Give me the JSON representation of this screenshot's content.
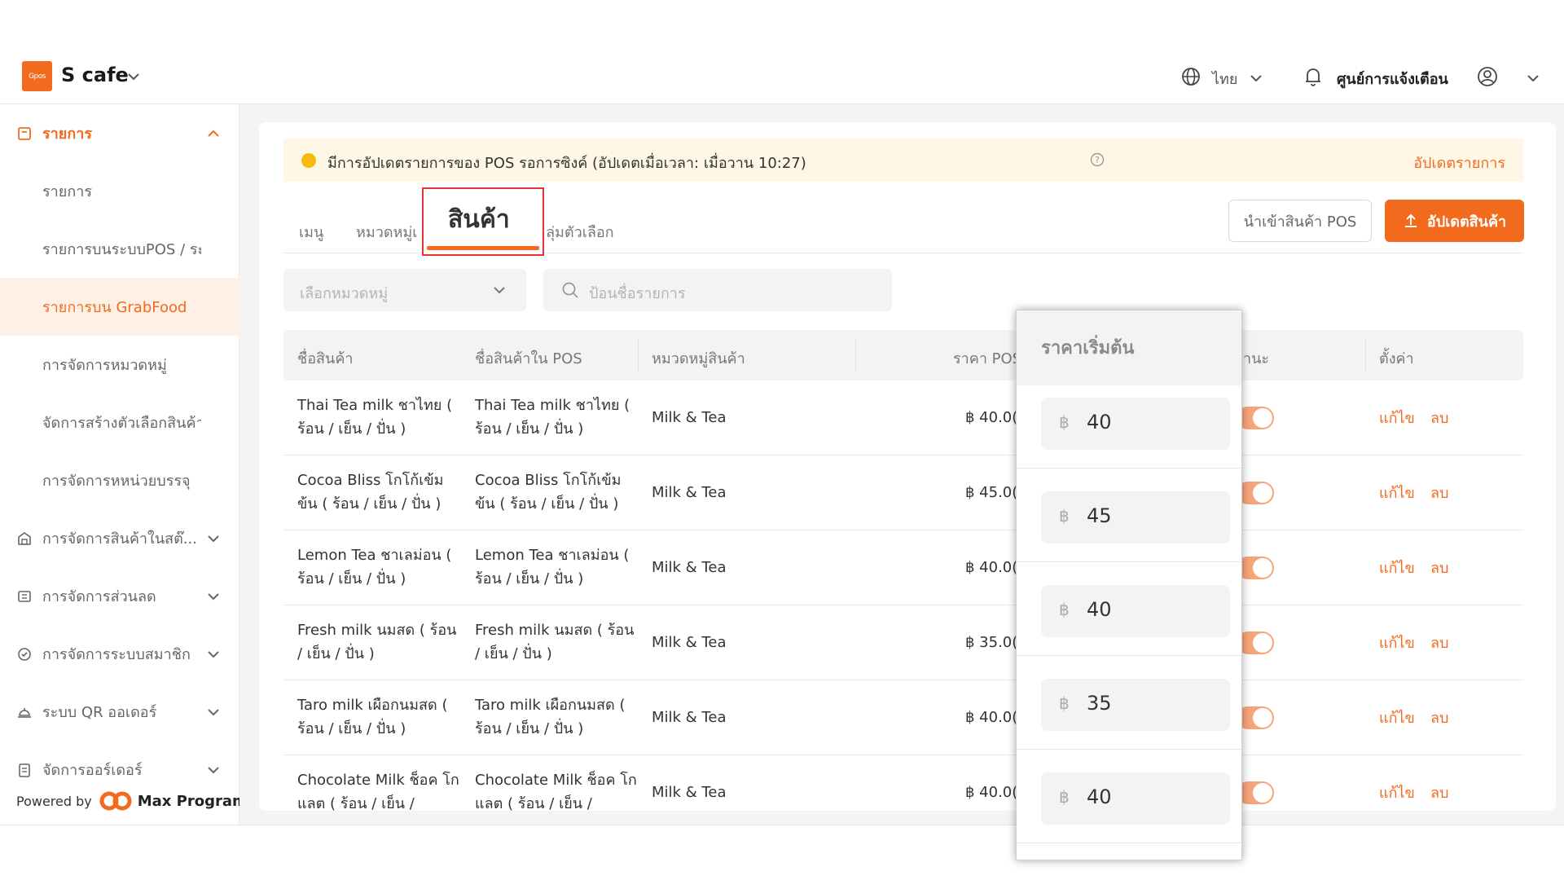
{
  "header": {
    "logo_text": "Gpos",
    "shop_name": "S cafe",
    "language": "ไทย",
    "notifications": "ศูนย์การแจ้งเตือน"
  },
  "sidebar": {
    "items": [
      {
        "label": "รายการ",
        "icon": "list-icon"
      },
      {
        "label": "รายการ"
      },
      {
        "label": "รายการบนระบบPOS / ระ..."
      },
      {
        "label": "รายการบน GrabFood"
      },
      {
        "label": "การจัดการหมวดหมู่"
      },
      {
        "label": "จัดการสร้างตัวเลือกสินค้า"
      },
      {
        "label": "การจัดการหหน่วยบรรจุ"
      },
      {
        "label": "การจัดการสินค้าในสต๊...",
        "icon": "warehouse-icon"
      },
      {
        "label": "การจัดการส่วนลด",
        "icon": "coupon-icon"
      },
      {
        "label": "การจัดการระบบสมาชิก",
        "icon": "member-icon"
      },
      {
        "label": "ระบบ QR ออเดอร์",
        "icon": "qr-order-icon"
      },
      {
        "label": "จัดการออร์เดอร์",
        "icon": "order-icon"
      }
    ],
    "powered_by": "Powered by",
    "brand": "Max Program"
  },
  "notice": {
    "text": "มีการอัปเดตรายการของ POS รอการซิงค์ (อัปเดตเมื่อเวลา: เมื่อวาน 10:27)",
    "link": "อัปเดตรายการ"
  },
  "tabs": {
    "menu": "เมนู",
    "category": "หมวดหมู่เ",
    "product": "สินค้า",
    "options": "ลุ่มตัวเลือก"
  },
  "buttons": {
    "import": "นำเข้าสินค้า POS",
    "update": "อัปเดตสินค้า"
  },
  "filters": {
    "category_placeholder": "เลือกหมวดหมู่",
    "search_placeholder": "ป้อนชื่อรายการ"
  },
  "table": {
    "headers": {
      "name": "ชื่อสินค้า",
      "pos_name": "ชื่อสินค้าใน POS",
      "category": "หมวดหมู่สินค้า",
      "price": "ราคา POS",
      "status": "านะ",
      "settings": "ตั้งค่า"
    },
    "rows": [
      {
        "name": "Thai Tea milk ชาไทย ( ร้อน / เย็น / ปั่น )",
        "pos_name": "Thai Tea milk ชาไทย ( ร้อน / เย็น / ปั่น )",
        "category": "Milk & Tea",
        "price": "฿ 40.0("
      },
      {
        "name": "Cocoa Bliss โกโก้เข้ม ข้น ( ร้อน / เย็น / ปั่น )",
        "pos_name": "Cocoa Bliss โกโก้เข้ม ข้น ( ร้อน / เย็น / ปั่น )",
        "category": "Milk & Tea",
        "price": "฿ 45.0("
      },
      {
        "name": "Lemon Tea ชาเลม่อน ( ร้อน / เย็น / ปั่น )",
        "pos_name": "Lemon Tea ชาเลม่อน ( ร้อน / เย็น / ปั่น )",
        "category": "Milk & Tea",
        "price": "฿ 40.0("
      },
      {
        "name": "Fresh milk นมสด ( ร้อน / เย็น / ปั่น )",
        "pos_name": "Fresh milk นมสด ( ร้อน / เย็น / ปั่น )",
        "category": "Milk & Tea",
        "price": "฿ 35.0("
      },
      {
        "name": "Taro milk เผือกนมสด ( ร้อน / เย็น / ปั่น )",
        "pos_name": "Taro milk เผือกนมสด ( ร้อน / เย็น / ปั่น )",
        "category": "Milk & Tea",
        "price": "฿ 40.0("
      },
      {
        "name": "Chocolate Milk ช็อค โกแลต ( ร้อน / เย็น /",
        "pos_name": "Chocolate Milk ช็อค โกแลต ( ร้อน / เย็น /",
        "category": "Milk & Tea",
        "price": "฿ 40.0("
      }
    ],
    "edit_label": "แก้ไข",
    "delete_label": "ลบ"
  },
  "callout": {
    "title": "ราคาเริ่มต้น",
    "currency": "฿",
    "prices": [
      "40",
      "45",
      "40",
      "35",
      "40"
    ]
  },
  "colors": {
    "accent": "#f26b1d",
    "notice_bg": "#fef7e6",
    "highlight_border": "#e63232"
  }
}
